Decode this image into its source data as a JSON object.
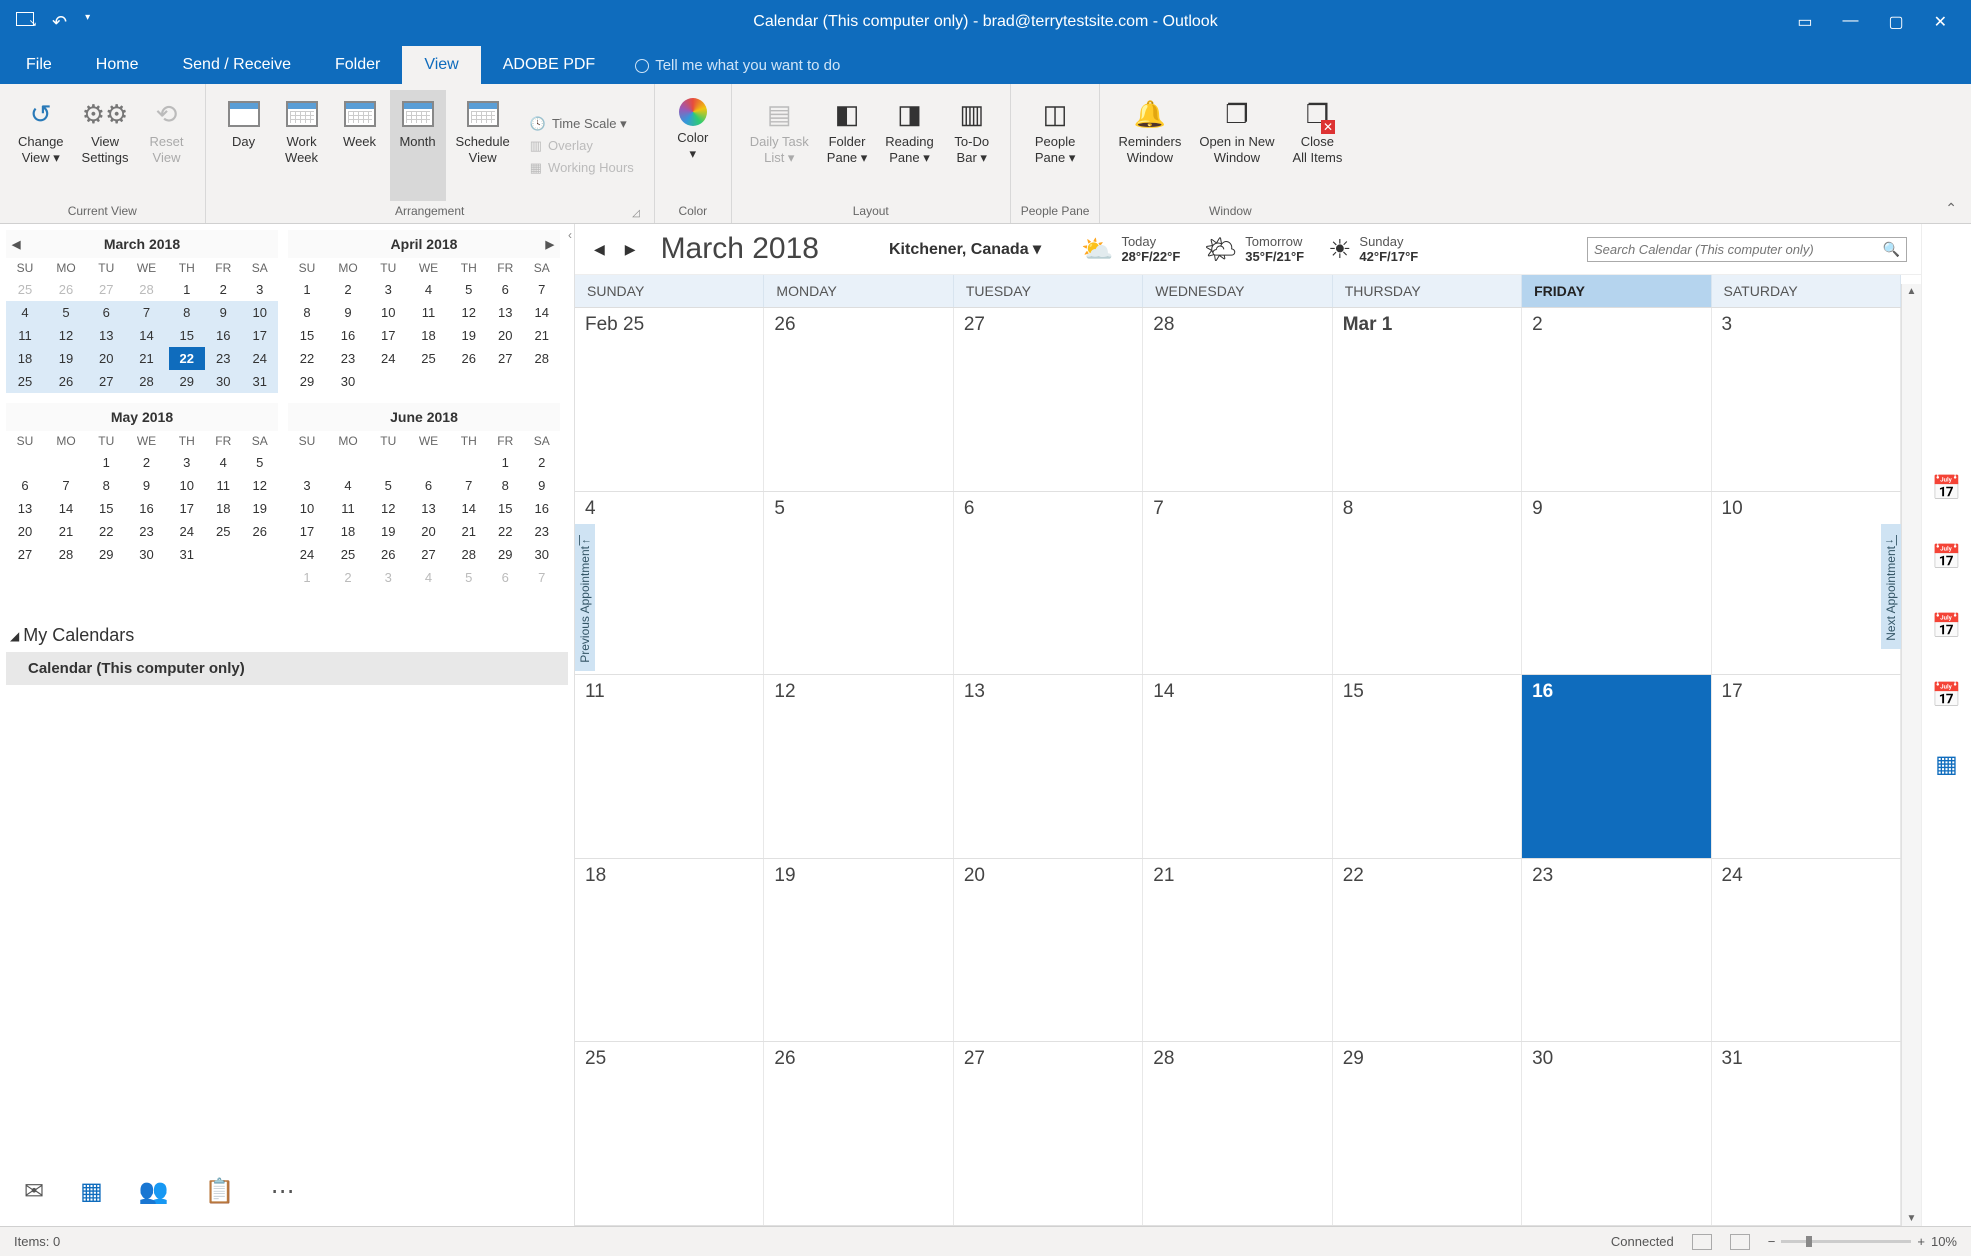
{
  "titlebar": {
    "title": "Calendar (This computer only) - brad@terrytestsite.com  -  Outlook"
  },
  "tabs": [
    "File",
    "Home",
    "Send / Receive",
    "Folder",
    "View",
    "ADOBE PDF"
  ],
  "tell_me": "Tell me what you want to do",
  "ribbon": {
    "current_view": {
      "change": "Change\nView ▾",
      "settings": "View\nSettings",
      "reset": "Reset\nView",
      "label": "Current View"
    },
    "arrangement": {
      "day": "Day",
      "workweek": "Work\nWeek",
      "week": "Week",
      "month": "Month",
      "schedule": "Schedule\nView",
      "timescale": "Time Scale ▾",
      "overlay": "Overlay",
      "workinghours": "Working Hours",
      "label": "Arrangement"
    },
    "color": {
      "color": "Color\n▾",
      "label": "Color"
    },
    "layout": {
      "daily": "Daily Task\nList ▾",
      "folder": "Folder\nPane ▾",
      "reading": "Reading\nPane ▾",
      "todo": "To-Do\nBar ▾",
      "label": "Layout"
    },
    "people": {
      "people": "People\nPane ▾",
      "label": "People Pane"
    },
    "window": {
      "reminders": "Reminders\nWindow",
      "openin": "Open in New\nWindow",
      "close": "Close\nAll Items",
      "label": "Window"
    }
  },
  "minicals": [
    {
      "title": "March 2018",
      "navleft": true,
      "shade": [
        1,
        2,
        3,
        4
      ],
      "today": [
        3,
        4
      ],
      "rows": [
        [
          "25",
          "26",
          "27",
          "28",
          "1",
          "2",
          "3"
        ],
        [
          "4",
          "5",
          "6",
          "7",
          "8",
          "9",
          "10"
        ],
        [
          "11",
          "12",
          "13",
          "14",
          "15",
          "16",
          "17"
        ],
        [
          "18",
          "19",
          "20",
          "21",
          "22",
          "23",
          "24"
        ],
        [
          "25",
          "26",
          "27",
          "28",
          "29",
          "30",
          "31"
        ]
      ],
      "dim": [
        [
          0,
          0
        ],
        [
          0,
          1
        ],
        [
          0,
          2
        ],
        [
          0,
          3
        ]
      ]
    },
    {
      "title": "April 2018",
      "navright": true,
      "rows": [
        [
          "1",
          "2",
          "3",
          "4",
          "5",
          "6",
          "7"
        ],
        [
          "8",
          "9",
          "10",
          "11",
          "12",
          "13",
          "14"
        ],
        [
          "15",
          "16",
          "17",
          "18",
          "19",
          "20",
          "21"
        ],
        [
          "22",
          "23",
          "24",
          "25",
          "26",
          "27",
          "28"
        ],
        [
          "29",
          "30",
          "",
          "",
          "",
          "",
          ""
        ]
      ]
    },
    {
      "title": "May 2018",
      "rows": [
        [
          "",
          "",
          "1",
          "2",
          "3",
          "4",
          "5"
        ],
        [
          "6",
          "7",
          "8",
          "9",
          "10",
          "11",
          "12"
        ],
        [
          "13",
          "14",
          "15",
          "16",
          "17",
          "18",
          "19"
        ],
        [
          "20",
          "21",
          "22",
          "23",
          "24",
          "25",
          "26"
        ],
        [
          "27",
          "28",
          "29",
          "30",
          "31",
          "",
          ""
        ]
      ]
    },
    {
      "title": "June 2018",
      "rows": [
        [
          "",
          "",
          "",
          "",
          "",
          "1",
          "2"
        ],
        [
          "3",
          "4",
          "5",
          "6",
          "7",
          "8",
          "9"
        ],
        [
          "10",
          "11",
          "12",
          "13",
          "14",
          "15",
          "16"
        ],
        [
          "17",
          "18",
          "19",
          "20",
          "21",
          "22",
          "23"
        ],
        [
          "24",
          "25",
          "26",
          "27",
          "28",
          "29",
          "30"
        ],
        [
          "1",
          "2",
          "3",
          "4",
          "5",
          "6",
          "7"
        ]
      ],
      "dim": [
        [
          5,
          0
        ],
        [
          5,
          1
        ],
        [
          5,
          2
        ],
        [
          5,
          3
        ],
        [
          5,
          4
        ],
        [
          5,
          5
        ],
        [
          5,
          6
        ]
      ]
    }
  ],
  "dow": [
    "SU",
    "MO",
    "TU",
    "WE",
    "TH",
    "FR",
    "SA"
  ],
  "mycalendars": {
    "header": "My Calendars",
    "item": "Calendar (This computer only)"
  },
  "calheader": {
    "month": "March 2018",
    "location": "Kitchener, Canada ▾",
    "weather": [
      {
        "icon": "⛅",
        "day": "Today",
        "temp": "28°F/22°F"
      },
      {
        "icon": "🌤",
        "day": "Tomorrow",
        "temp": "35°F/21°F"
      },
      {
        "icon": "☀",
        "day": "Sunday",
        "temp": "42°F/17°F"
      }
    ],
    "search_placeholder": "Search Calendar (This computer only)"
  },
  "dayheaders": [
    "SUNDAY",
    "MONDAY",
    "TUESDAY",
    "WEDNESDAY",
    "THURSDAY",
    "FRIDAY",
    "SATURDAY"
  ],
  "today_col": 5,
  "grid": [
    [
      {
        "t": "Feb 25"
      },
      {
        "t": "26"
      },
      {
        "t": "27"
      },
      {
        "t": "28"
      },
      {
        "t": "Mar 1",
        "b": true
      },
      {
        "t": "2"
      },
      {
        "t": "3"
      }
    ],
    [
      {
        "t": "4"
      },
      {
        "t": "5"
      },
      {
        "t": "6"
      },
      {
        "t": "7"
      },
      {
        "t": "8"
      },
      {
        "t": "9"
      },
      {
        "t": "10"
      }
    ],
    [
      {
        "t": "11"
      },
      {
        "t": "12"
      },
      {
        "t": "13"
      },
      {
        "t": "14"
      },
      {
        "t": "15"
      },
      {
        "t": "16",
        "today": true
      },
      {
        "t": "17"
      }
    ],
    [
      {
        "t": "18"
      },
      {
        "t": "19"
      },
      {
        "t": "20"
      },
      {
        "t": "21"
      },
      {
        "t": "22"
      },
      {
        "t": "23"
      },
      {
        "t": "24"
      }
    ],
    [
      {
        "t": "25"
      },
      {
        "t": "26"
      },
      {
        "t": "27"
      },
      {
        "t": "28"
      },
      {
        "t": "29"
      },
      {
        "t": "30"
      },
      {
        "t": "31"
      }
    ]
  ],
  "prev_appt": "Previous Appointment",
  "next_appt": "Next Appointment",
  "status": {
    "items": "Items: 0",
    "connected": "Connected",
    "zoom": "10%"
  }
}
